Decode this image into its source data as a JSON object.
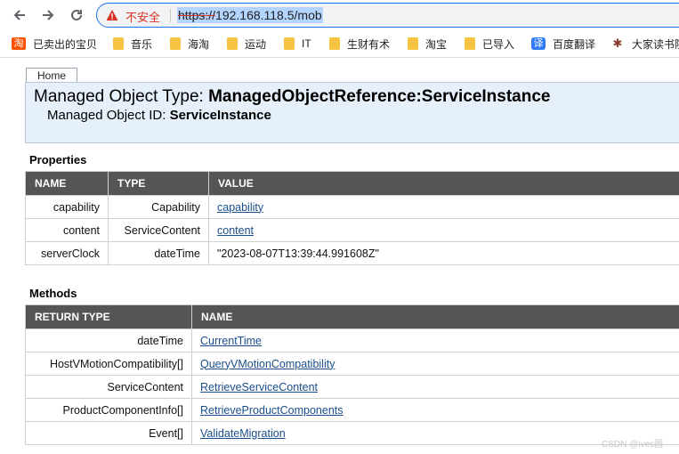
{
  "browser": {
    "security_warning": "不安全",
    "url_scheme": "https://",
    "url_rest": "192.168.118.5/mob",
    "bookmarks": [
      {
        "label": "已卖出的宝贝",
        "icon": "taobao-icon"
      },
      {
        "label": "音乐",
        "icon": "folder-icon"
      },
      {
        "label": "海淘",
        "icon": "folder-icon"
      },
      {
        "label": "运动",
        "icon": "folder-icon"
      },
      {
        "label": "IT",
        "icon": "folder-icon"
      },
      {
        "label": "生财有术",
        "icon": "folder-icon"
      },
      {
        "label": "淘宝",
        "icon": "folder-icon"
      },
      {
        "label": "已导入",
        "icon": "folder-icon"
      },
      {
        "label": "百度翻译",
        "icon": "translate-icon"
      },
      {
        "label": "大家读书院",
        "icon": "bug-icon"
      }
    ]
  },
  "page": {
    "home_tab": "Home",
    "managed_object_type_label": "Managed Object Type:",
    "managed_object_type_value": "ManagedObjectReference:ServiceInstance",
    "managed_object_id_label": "Managed Object ID:",
    "managed_object_id_value": "ServiceInstance",
    "properties": {
      "title": "Properties",
      "headers": [
        "NAME",
        "TYPE",
        "VALUE"
      ],
      "rows": [
        {
          "name": "capability",
          "type": "Capability",
          "value": "capability",
          "link": true
        },
        {
          "name": "content",
          "type": "ServiceContent",
          "value": "content",
          "link": true
        },
        {
          "name": "serverClock",
          "type": "dateTime",
          "value": "\"2023-08-07T13:39:44.991608Z\"",
          "link": false
        }
      ]
    },
    "methods": {
      "title": "Methods",
      "headers": [
        "RETURN TYPE",
        "NAME"
      ],
      "rows": [
        {
          "return_type": "dateTime",
          "name": "CurrentTime"
        },
        {
          "return_type": "HostVMotionCompatibility[]",
          "name": "QueryVMotionCompatibility"
        },
        {
          "return_type": "ServiceContent",
          "name": "RetrieveServiceContent"
        },
        {
          "return_type": "ProductComponentInfo[]",
          "name": "RetrieveProductComponents"
        },
        {
          "return_type": "Event[]",
          "name": "ValidateMigration"
        }
      ]
    }
  },
  "watermark": "CSDN @ives圆",
  "colors": {
    "header_bg": "#e6f0fa",
    "table_header_bg": "#555555",
    "link": "#1a4e8c",
    "warning": "#d93025"
  }
}
